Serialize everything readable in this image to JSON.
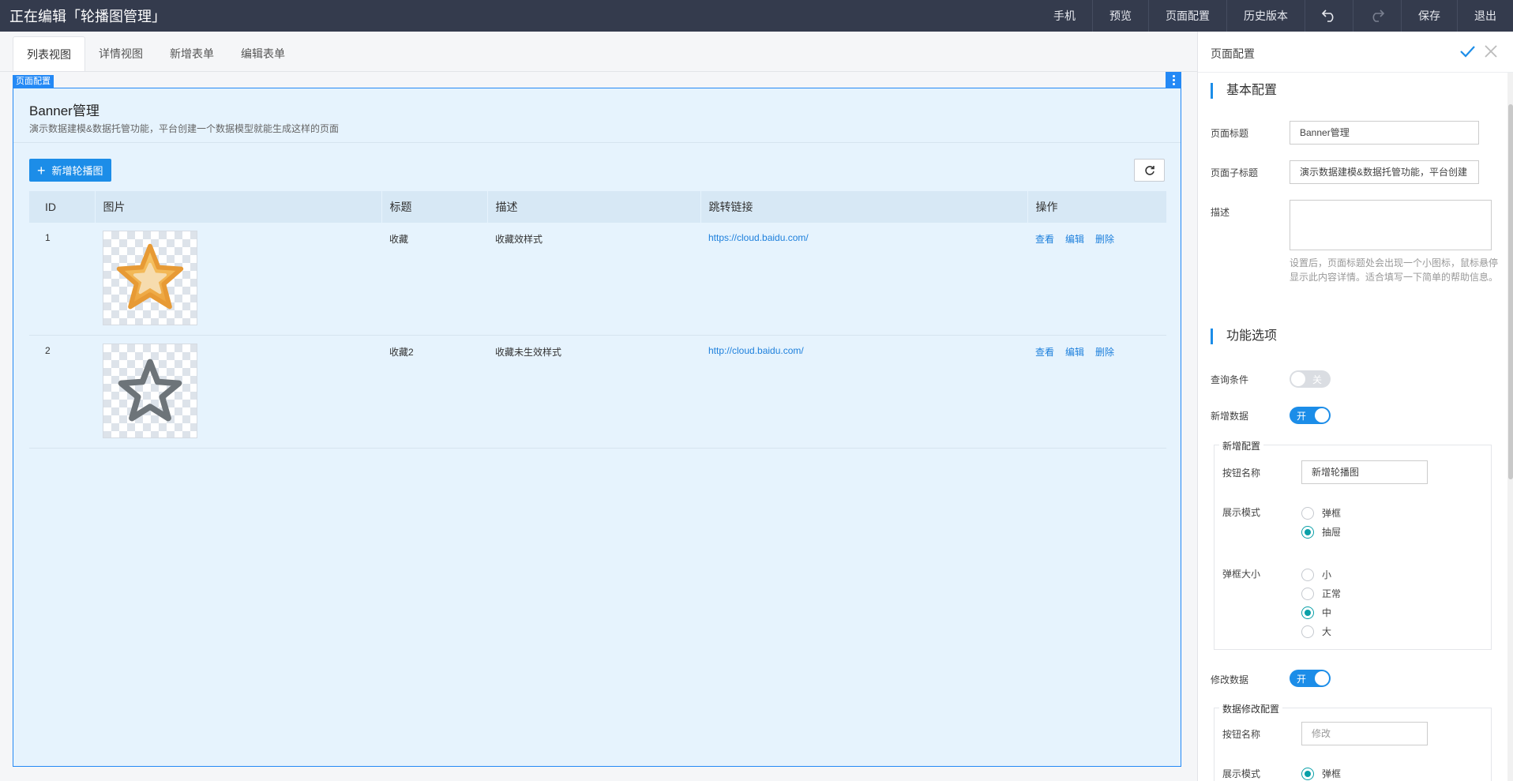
{
  "header": {
    "title": "正在编辑「轮播图管理」",
    "actions": {
      "phone": "手机",
      "preview": "预览",
      "page_config": "页面配置",
      "history": "历史版本",
      "save": "保存",
      "exit": "退出"
    }
  },
  "tabs": [
    "列表视图",
    "详情视图",
    "新增表单",
    "编辑表单"
  ],
  "config_tag": "页面配置",
  "page": {
    "title": "Banner管理",
    "subtitle": "演示数据建模&数据托管功能，平台创建一个数据模型就能生成这样的页面",
    "add_button": "新增轮播图"
  },
  "table": {
    "columns": [
      "ID",
      "图片",
      "标题",
      "描述",
      "跳转链接",
      "操作"
    ],
    "rows": [
      {
        "id": "1",
        "image": "star-filled",
        "title": "收藏",
        "desc": "收藏效样式",
        "link": "https://cloud.baidu.com/",
        "ops": [
          "查看",
          "编辑",
          "删除"
        ]
      },
      {
        "id": "2",
        "image": "star-outline",
        "title": "收藏2",
        "desc": "收藏未生效样式",
        "link": "http://cloud.baidu.com/",
        "ops": [
          "查看",
          "编辑",
          "删除"
        ]
      }
    ]
  },
  "panel": {
    "title": "页面配置",
    "basic_section": "基本配置",
    "page_title_label": "页面标题",
    "page_title_value": "Banner管理",
    "page_subtitle_label": "页面子标题",
    "page_subtitle_value": "演示数据建模&数据托管功能，平台创建",
    "desc_label": "描述",
    "desc_help": "设置后，页面标题处会出现一个小图标，鼠标悬停显示此内容详情。适合填写一下简单的帮助信息。",
    "func_section": "功能选项",
    "query_label": "查询条件",
    "query_toggle": "关",
    "add_label": "新增数据",
    "add_toggle": "开",
    "add_config": {
      "legend": "新增配置",
      "button_name_label": "按钮名称",
      "button_name_value": "新增轮播图",
      "display_mode_label": "展示模式",
      "display_modes": [
        "弹框",
        "抽屉"
      ],
      "dialog_size_label": "弹框大小",
      "dialog_sizes": [
        "小",
        "正常",
        "中",
        "大"
      ]
    },
    "edit_label": "修改数据",
    "edit_toggle": "开",
    "edit_config": {
      "legend": "数据修改配置",
      "button_name_label": "按钮名称",
      "button_name_placeholder": "修改",
      "display_mode_label": "展示模式",
      "display_mode_first": "弹框"
    }
  }
}
